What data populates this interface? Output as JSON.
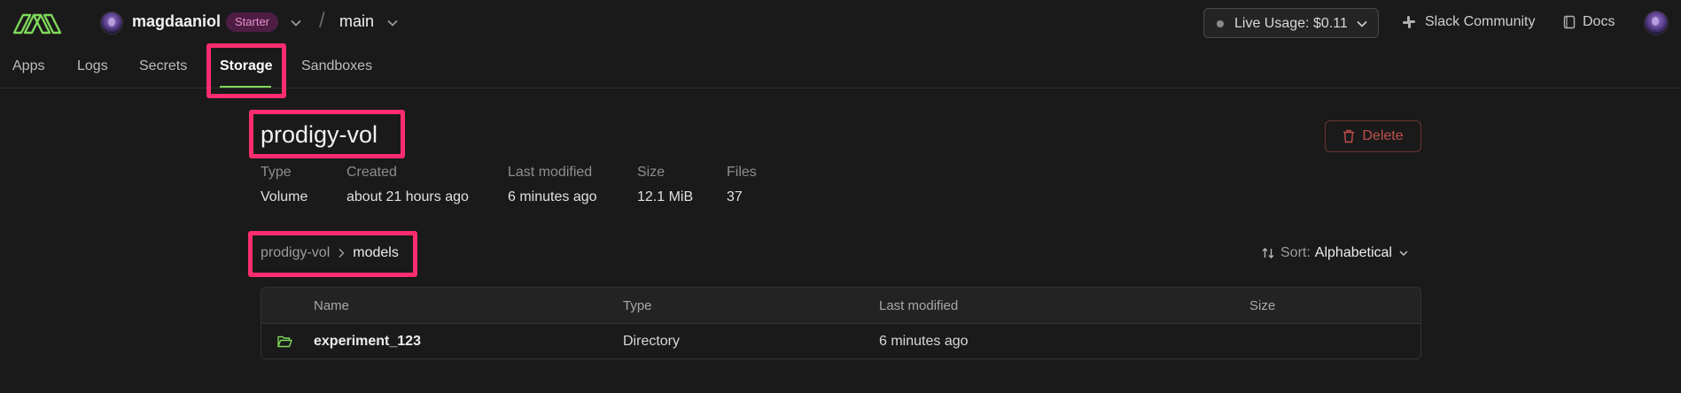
{
  "header": {
    "org_name": "magdaaniol",
    "plan_badge": "Starter",
    "separator": "/",
    "environment": "main",
    "live_usage": "Live Usage: $0.11",
    "slack": "Slack Community",
    "docs": "Docs",
    "icons": [
      "modal-logo",
      "avatar",
      "chevron-down-icon",
      "slack-icon",
      "book-icon"
    ]
  },
  "tabs": [
    "Apps",
    "Logs",
    "Secrets",
    "Storage",
    "Sandboxes"
  ],
  "active_tab": "Storage",
  "volume": {
    "title": "prodigy-vol",
    "delete_label": "Delete",
    "meta": {
      "type": {
        "label": "Type",
        "value": "Volume"
      },
      "created": {
        "label": "Created",
        "value": "about 21 hours ago"
      },
      "modified": {
        "label": "Last modified",
        "value": "6 minutes ago"
      },
      "size": {
        "label": "Size",
        "value": "12.1 MiB"
      },
      "files": {
        "label": "Files",
        "value": "37"
      }
    }
  },
  "breadcrumb": {
    "root": "prodigy-vol",
    "current": "models"
  },
  "sort": {
    "label": "Sort:",
    "value": "Alphabetical"
  },
  "table": {
    "columns": [
      "Name",
      "Type",
      "Last modified",
      "Size"
    ],
    "rows": [
      {
        "name": "experiment_123",
        "type": "Directory",
        "modified": "6 minutes ago",
        "size": "",
        "icon": "folder-open-icon"
      }
    ]
  },
  "colors": {
    "background": "#1a1a1a",
    "accent_green": "#7fd85b",
    "highlight": "#ff2d6f",
    "danger": "#c0504d",
    "badge_bg": "#4d1d44",
    "badge_text": "#e88fd0"
  }
}
